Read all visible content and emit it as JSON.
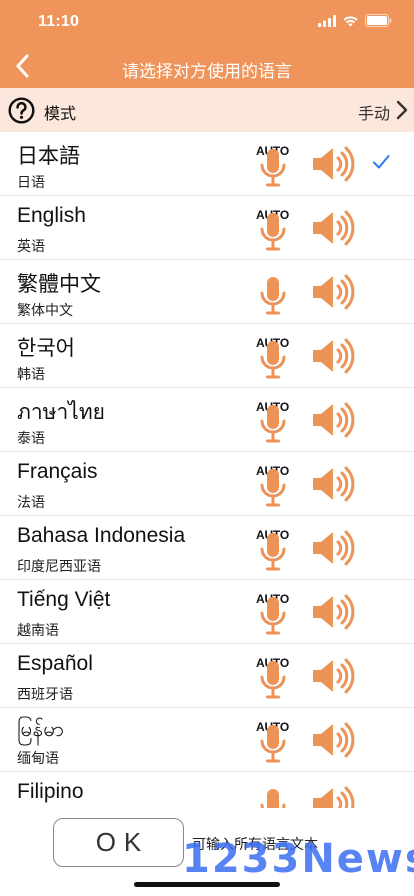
{
  "status": {
    "time": "11:10"
  },
  "nav": {
    "title": "请选择对方使用的语言"
  },
  "mode": {
    "label": "模式",
    "value": "手动"
  },
  "auto_badge": "AUTO",
  "languages": [
    {
      "name": "日本語",
      "sub": "日语",
      "auto": true,
      "selected": true
    },
    {
      "name": "English",
      "sub": "英语",
      "auto": true,
      "selected": false
    },
    {
      "name": "繁體中文",
      "sub": "繁体中文",
      "auto": false,
      "selected": false
    },
    {
      "name": "한국어",
      "sub": "韩语",
      "auto": true,
      "selected": false
    },
    {
      "name": "ภาษาไทย",
      "sub": "泰语",
      "auto": true,
      "selected": false
    },
    {
      "name": "Français",
      "sub": "法语",
      "auto": true,
      "selected": false
    },
    {
      "name": "Bahasa Indonesia",
      "sub": "印度尼西亚语",
      "auto": true,
      "selected": false
    },
    {
      "name": "Tiếng Việt",
      "sub": "越南语",
      "auto": true,
      "selected": false
    },
    {
      "name": "Español",
      "sub": "西班牙语",
      "auto": true,
      "selected": false
    },
    {
      "name": "မြန်မာ",
      "sub": "缅甸语",
      "auto": true,
      "selected": false
    },
    {
      "name": "Filipino",
      "sub": "",
      "auto": false,
      "selected": false
    }
  ],
  "bottom": {
    "ok_label": "OK",
    "hint": "可输入所有语言文本",
    "watermark": "1233News"
  },
  "colors": {
    "header": "#ef955b",
    "mode_row": "#fbe7db",
    "icon_orange": "#ee9356",
    "check_blue": "#2f7af6"
  },
  "icons": {
    "back": "chevron-left-icon",
    "help": "question-circle-icon",
    "mic": "microphone-icon",
    "speaker": "speaker-icon",
    "check": "checkmark-icon"
  }
}
